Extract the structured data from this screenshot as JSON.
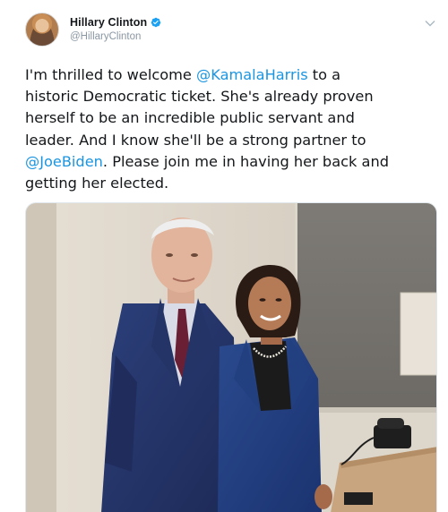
{
  "tweet": {
    "author": {
      "display_name": "Hillary Clinton",
      "handle": "@HillaryClinton",
      "verified": true
    },
    "text_lines": [
      [
        {
          "t": "I'm thrilled to welcome "
        },
        {
          "t": "@KamalaHarris",
          "m": true
        },
        {
          "t": " to a"
        }
      ],
      [
        {
          "t": "historic Democratic ticket. She's already proven"
        }
      ],
      [
        {
          "t": "herself to be an incredible public servant and"
        }
      ],
      [
        {
          "t": "leader. And I know she'll be a strong partner to"
        }
      ],
      [
        {
          "t": "@JoeBiden",
          "m": true
        },
        {
          "t": ". Please join me in having her back and"
        }
      ],
      [
        {
          "t": "getting her elected."
        }
      ]
    ],
    "media": {
      "kind": "photo"
    }
  },
  "icons": {
    "verified": "verified-badge-icon",
    "menu": "chevron-down-icon"
  },
  "colors": {
    "mention": "#1b95e0",
    "verified": "#1da1f2",
    "handle": "#8a97a3"
  }
}
